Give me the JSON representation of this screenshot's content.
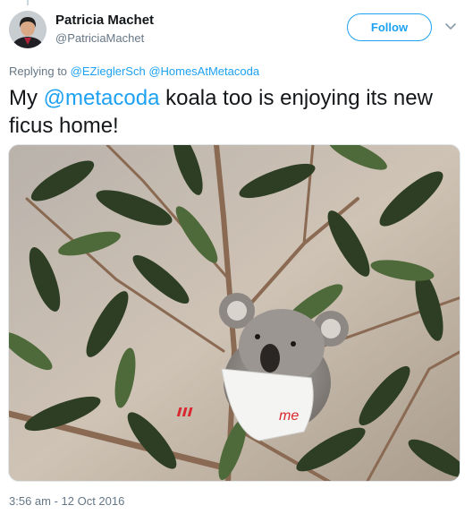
{
  "user": {
    "name": "Patricia Machet",
    "handle": "@PatriciaMachet"
  },
  "follow_label": "Follow",
  "replying": {
    "prefix": "Replying to",
    "mentions": [
      "@EZieglerSch",
      "@HomesAtMetacoda"
    ]
  },
  "tweet": {
    "text_before": "My ",
    "mention": "@metacoda",
    "text_after": " koala too is enjoying its new ficus home!"
  },
  "photo": {
    "cup_text": "me"
  },
  "timestamp": "3:56 am - 12 Oct 2016",
  "colors": {
    "link": "#1da1f2",
    "secondary_text": "#657786",
    "primary_text": "#14171a"
  }
}
